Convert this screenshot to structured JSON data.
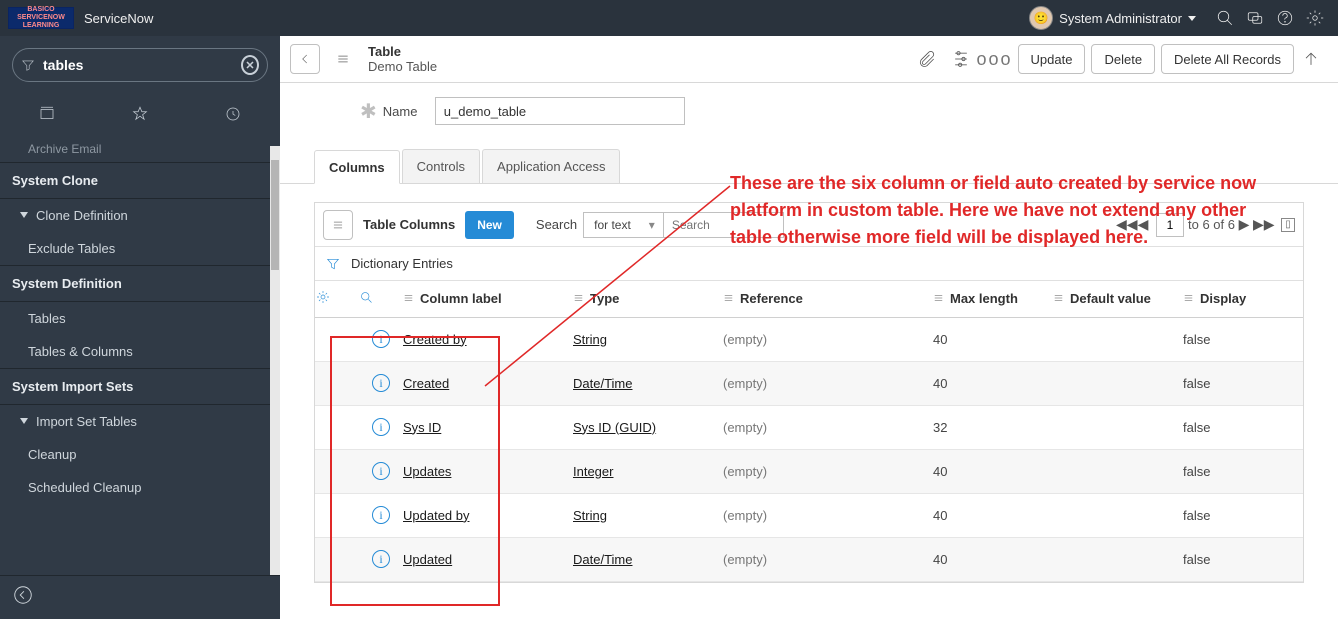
{
  "banner": {
    "logo": "BASICO SERVICENOW LEARNING",
    "brand": "ServiceNow",
    "user": "System Administrator"
  },
  "sidebar": {
    "filter": "tables",
    "truncated_top": "Archive Email",
    "sections": [
      {
        "header": "System Clone",
        "groups": [
          {
            "label": "Clone Definition",
            "items": [
              "Exclude Tables"
            ]
          }
        ]
      },
      {
        "header": "System Definition",
        "items": [
          "Tables",
          "Tables & Columns"
        ]
      },
      {
        "header": "System Import Sets",
        "groups": [
          {
            "label": "Import Set Tables",
            "items": [
              "Cleanup",
              "Scheduled Cleanup"
            ]
          }
        ]
      }
    ]
  },
  "form_header": {
    "title": "Table",
    "subtitle": "Demo Table",
    "buttons": {
      "update": "Update",
      "delete": "Delete",
      "delete_all": "Delete All Records"
    }
  },
  "form": {
    "name_label": "Name",
    "name_value": "u_demo_table"
  },
  "tabs": [
    "Columns",
    "Controls",
    "Application Access"
  ],
  "list": {
    "title": "Table Columns",
    "new_label": "New",
    "search_label": "Search",
    "search_mode": "for text",
    "search_placeholder": "Search",
    "paging": {
      "from": "1",
      "total_text": "to 6 of 6"
    },
    "dict_label": "Dictionary Entries",
    "columns": [
      "Column label",
      "Type",
      "Reference",
      "Max length",
      "Default value",
      "Display"
    ],
    "rows": [
      {
        "label": "Created by",
        "type": "String",
        "ref": "(empty)",
        "max": "40",
        "def": "",
        "disp": "false"
      },
      {
        "label": "Created",
        "type": "Date/Time",
        "ref": "(empty)",
        "max": "40",
        "def": "",
        "disp": "false"
      },
      {
        "label": "Sys ID",
        "type": "Sys ID (GUID)",
        "ref": "(empty)",
        "max": "32",
        "def": "",
        "disp": "false"
      },
      {
        "label": "Updates",
        "type": "Integer",
        "ref": "(empty)",
        "max": "40",
        "def": "",
        "disp": "false"
      },
      {
        "label": "Updated by",
        "type": "String",
        "ref": "(empty)",
        "max": "40",
        "def": "",
        "disp": "false"
      },
      {
        "label": "Updated",
        "type": "Date/Time",
        "ref": "(empty)",
        "max": "40",
        "def": "",
        "disp": "false"
      }
    ]
  },
  "annotation": {
    "text": "These are the six column or field auto created by service now platform in custom table. Here we have not extend any other table otherwise more field will be displayed here."
  }
}
